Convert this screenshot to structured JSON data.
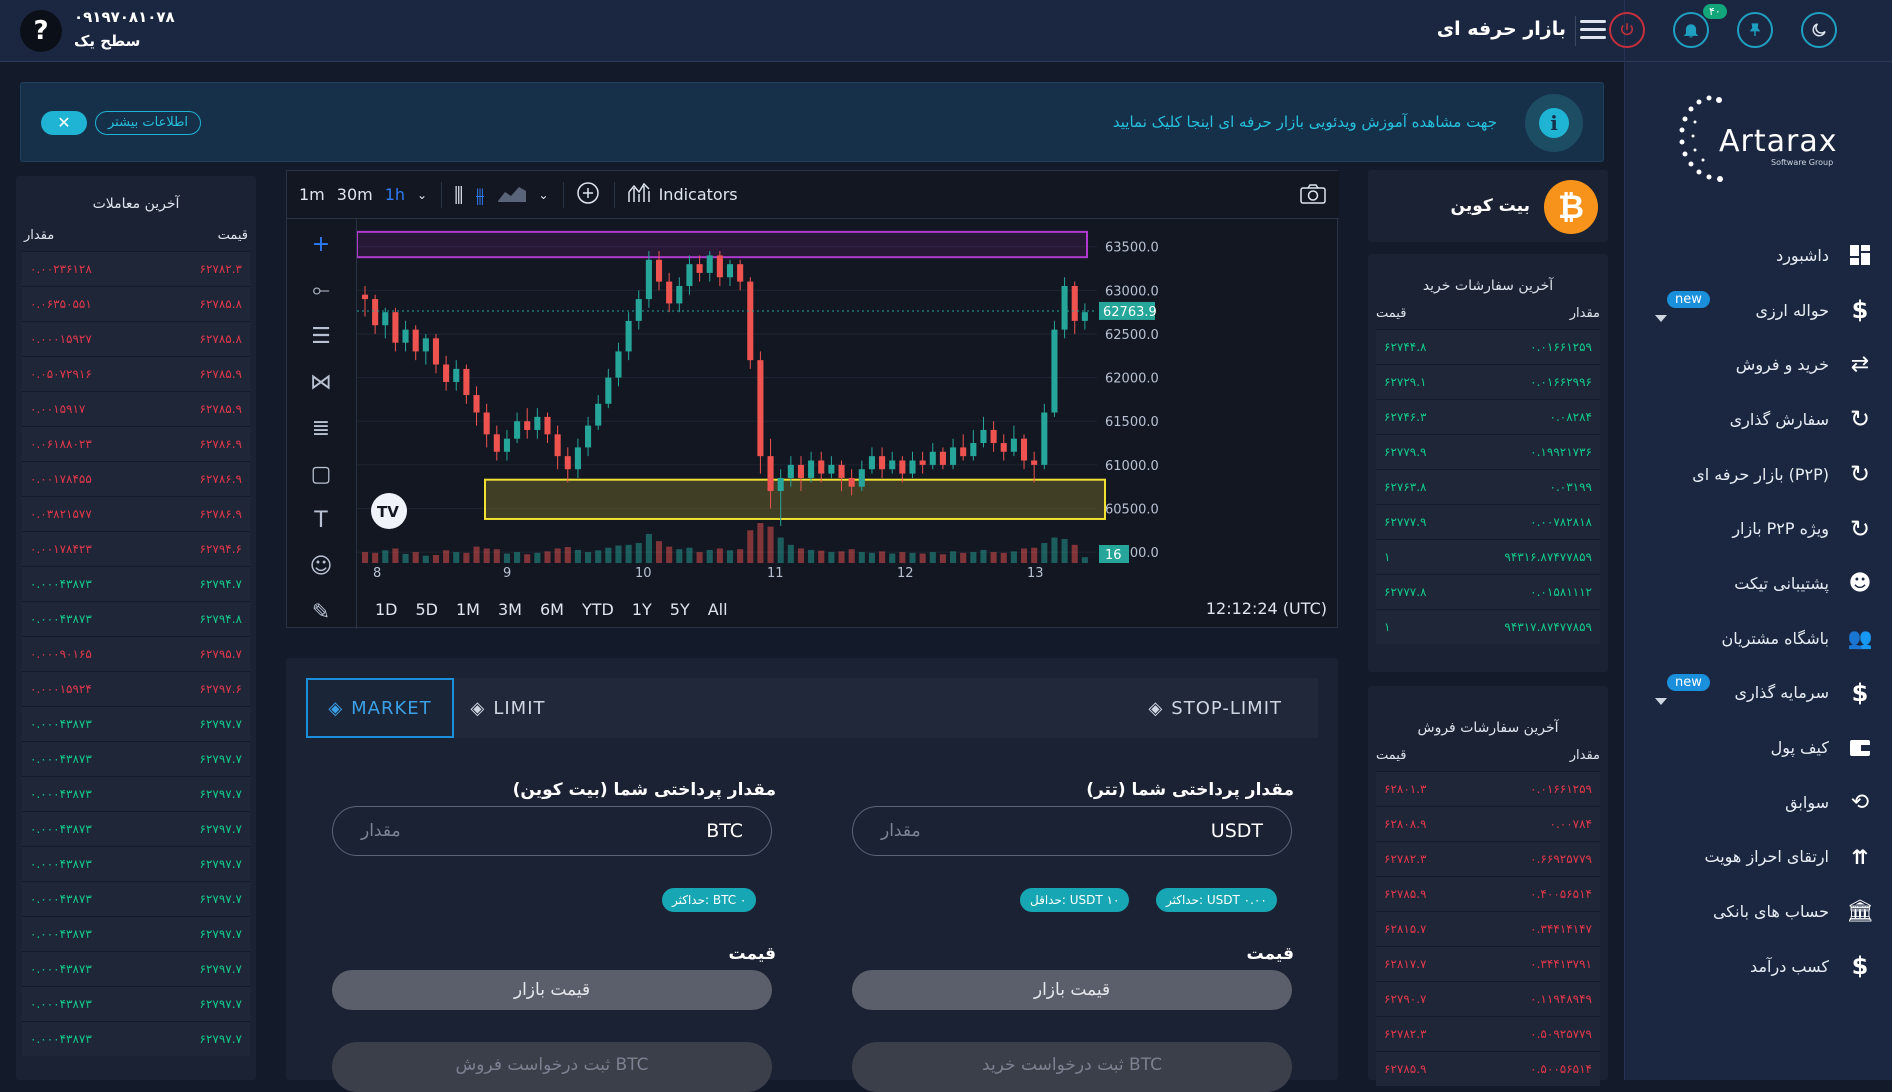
{
  "header": {
    "phone": "۰۹۱۹۷۰۸۱۰۷۸",
    "level": "سطح یک",
    "help_label": "?",
    "page_title": "بازار حرفه ای",
    "notif_count": "۴۰"
  },
  "banner": {
    "text": "جهت مشاهده آموزش ویدئویی بازار حرفه ای اینجا کلیک نمایید",
    "more_label": "اطلاعات بیشتر",
    "close_label": "✕",
    "info_label": "i"
  },
  "sidebar": {
    "logo_text": "Artarax",
    "logo_sub": "Software Group",
    "items": [
      {
        "label": "داشبورد",
        "icon": "dashboard-icon"
      },
      {
        "label": "حواله ارزی",
        "icon": "dollar-icon",
        "badge": "new"
      },
      {
        "label": "خرید و فروش",
        "icon": "exchange-icon"
      },
      {
        "label": "سفارش گذاری",
        "icon": "refresh-icon"
      },
      {
        "label": "بازار حرفه ای (P۲P)",
        "icon": "refresh-icon"
      },
      {
        "label": "بازار P۲P ویژه",
        "icon": "refresh-icon"
      },
      {
        "label": "پشتیبانی تیکت",
        "icon": "support-icon"
      },
      {
        "label": "باشگاه مشتریان",
        "icon": "users-icon"
      },
      {
        "label": "سرمایه گذاری",
        "icon": "dollar-icon",
        "badge": "new"
      },
      {
        "label": "کیف پول",
        "icon": "wallet-icon"
      },
      {
        "label": "سوابق",
        "icon": "history-icon"
      },
      {
        "label": "ارتقای احراز هویت",
        "icon": "chevrons-up-icon"
      },
      {
        "label": "حساب های بانکی",
        "icon": "bank-icon"
      },
      {
        "label": "کسب درآمد",
        "icon": "dollar-icon"
      }
    ]
  },
  "coin": {
    "name": "بیت کوین",
    "icon": "bitcoin-icon",
    "symbol": "₿"
  },
  "buy_orders": {
    "title": "آخرین سفارشات خرید",
    "col_amount": "مقدار",
    "col_price": "قیمت",
    "rows": [
      {
        "amount": "۰.۰۱۶۶۱۲۵۹",
        "price": "۶۲۷۴۴.۸"
      },
      {
        "amount": "۰.۰۱۶۶۲۹۹۶",
        "price": "۶۲۷۲۹.۱"
      },
      {
        "amount": "۰.۰۸۲۸۴",
        "price": "۶۲۷۴۶.۳"
      },
      {
        "amount": "۰.۱۹۹۲۱۷۳۶",
        "price": "۶۲۷۷۹.۹"
      },
      {
        "amount": "۰.۰۳۱۹۹",
        "price": "۶۲۷۶۳.۸"
      },
      {
        "amount": "۰.۰۰۷۸۲۸۱۸",
        "price": "۶۲۷۷۷.۹"
      },
      {
        "amount": "۹۴۳۱۶.۸۷۴۷۷۸۵۹",
        "price": "۱"
      },
      {
        "amount": "۰.۰۱۵۸۱۱۱۲",
        "price": "۶۲۷۷۷.۸"
      },
      {
        "amount": "۹۴۳۱۷.۸۷۴۷۷۸۵۹",
        "price": "۱"
      }
    ]
  },
  "sell_orders": {
    "title": "آخرین سفارشات فروش",
    "col_amount": "مقدار",
    "col_price": "قیمت",
    "rows": [
      {
        "amount": "۰.۰۱۶۶۱۲۵۹",
        "price": "۶۲۸۰۱.۳"
      },
      {
        "amount": "۰.۰۰۷۸۴",
        "price": "۶۲۸۰۸.۹"
      },
      {
        "amount": "۰.۶۶۹۲۵۷۷۹",
        "price": "۶۲۷۸۲.۳"
      },
      {
        "amount": "۰.۴۰۰۵۶۵۱۴",
        "price": "۶۲۷۸۵.۹"
      },
      {
        "amount": "۰.۳۴۴۱۴۱۴۷",
        "price": "۶۲۸۱۵.۷"
      },
      {
        "amount": "۰.۳۴۴۱۳۷۹۱",
        "price": "۶۲۸۱۷.۷"
      },
      {
        "amount": "۰.۱۱۹۴۸۹۴۹",
        "price": "۶۲۷۹۰.۷"
      },
      {
        "amount": "۰.۵۰۹۲۵۷۷۹",
        "price": "۶۲۷۸۲.۳"
      },
      {
        "amount": "۰.۵۰۰۵۶۵۱۴",
        "price": "۶۲۷۸۵.۹"
      }
    ]
  },
  "trades": {
    "title": "آخرین معاملات",
    "col_amount": "مقدار",
    "col_price": "قیمت",
    "rows": [
      {
        "amount": "۰.۰۰۲۳۶۱۲۸",
        "price": "۶۲۷۸۲.۳",
        "side": "sell"
      },
      {
        "amount": "۰.۰۶۳۵۰۵۵۱",
        "price": "۶۲۷۸۵.۸",
        "side": "sell"
      },
      {
        "amount": "۰.۰۰۰۱۵۹۲۷",
        "price": "۶۲۷۸۵.۸",
        "side": "sell"
      },
      {
        "amount": "۰.۰۵۰۷۲۹۱۶",
        "price": "۶۲۷۸۵.۹",
        "side": "sell"
      },
      {
        "amount": "۰.۰۰۱۵۹۱۷",
        "price": "۶۲۷۸۵.۹",
        "side": "sell"
      },
      {
        "amount": "۰.۰۶۱۸۸۰۲۳",
        "price": "۶۲۷۸۶.۹",
        "side": "sell"
      },
      {
        "amount": "۰.۰۰۱۷۸۴۵۵",
        "price": "۶۲۷۸۶.۹",
        "side": "sell"
      },
      {
        "amount": "۰.۰۳۸۲۱۵۷۷",
        "price": "۶۲۷۸۶.۹",
        "side": "sell"
      },
      {
        "amount": "۰.۰۰۱۷۸۴۲۳",
        "price": "۶۲۷۹۴.۶",
        "side": "sell"
      },
      {
        "amount": "۰.۰۰۰۴۳۸۷۳",
        "price": "۶۲۷۹۴.۷",
        "side": "buy"
      },
      {
        "amount": "۰.۰۰۰۴۳۸۷۳",
        "price": "۶۲۷۹۴.۸",
        "side": "buy"
      },
      {
        "amount": "۰.۰۰۰۹۰۱۶۵",
        "price": "۶۲۷۹۵.۷",
        "side": "sell"
      },
      {
        "amount": "۰.۰۰۰۱۵۹۲۴",
        "price": "۶۲۷۹۷.۶",
        "side": "sell"
      },
      {
        "amount": "۰.۰۰۰۴۳۸۷۳",
        "price": "۶۲۷۹۷.۷",
        "side": "buy"
      },
      {
        "amount": "۰.۰۰۰۴۳۸۷۳",
        "price": "۶۲۷۹۷.۷",
        "side": "buy"
      },
      {
        "amount": "۰.۰۰۰۴۳۸۷۳",
        "price": "۶۲۷۹۷.۷",
        "side": "buy"
      },
      {
        "amount": "۰.۰۰۰۴۳۸۷۳",
        "price": "۶۲۷۹۷.۷",
        "side": "buy"
      },
      {
        "amount": "۰.۰۰۰۴۳۸۷۳",
        "price": "۶۲۷۹۷.۷",
        "side": "buy"
      },
      {
        "amount": "۰.۰۰۰۴۳۸۷۳",
        "price": "۶۲۷۹۷.۷",
        "side": "buy"
      },
      {
        "amount": "۰.۰۰۰۴۳۸۷۳",
        "price": "۶۲۷۹۷.۷",
        "side": "buy"
      },
      {
        "amount": "۰.۰۰۰۴۳۸۷۳",
        "price": "۶۲۷۹۷.۷",
        "side": "buy"
      },
      {
        "amount": "۰.۰۰۰۴۳۸۷۳",
        "price": "۶۲۷۹۷.۷",
        "side": "buy"
      },
      {
        "amount": "۰.۰۰۰۴۳۸۷۳",
        "price": "۶۲۷۹۷.۷",
        "side": "buy"
      }
    ]
  },
  "chart_toolbar": {
    "intervals": [
      "1m",
      "30m",
      "1h"
    ],
    "active_interval": "1h",
    "indicators_label": "Indicators"
  },
  "chart_footer": {
    "ranges": [
      "1D",
      "5D",
      "1M",
      "3M",
      "6M",
      "YTD",
      "1Y",
      "5Y",
      "All"
    ],
    "clock": "12:12:24 (UTC)"
  },
  "chart_data": {
    "type": "candlestick",
    "x_ticks": [
      "8",
      "9",
      "10",
      "11",
      "12",
      "13"
    ],
    "y_ticks": [
      63500.0,
      63000.0,
      62500.0,
      62000.0,
      61500.0,
      61000.0,
      60500.0,
      60000.0
    ],
    "ylim": [
      59990,
      63680
    ],
    "last_price": "62763.9",
    "last_volume": "16",
    "resistance_zone": [
      63380,
      63670
    ],
    "support_zone": [
      60380,
      60830
    ],
    "candles": [
      [
        62950,
        62900,
        63050,
        62700
      ],
      [
        62900,
        62600,
        62950,
        62500
      ],
      [
        62600,
        62750,
        62800,
        62450
      ],
      [
        62750,
        62400,
        62800,
        62300
      ],
      [
        62400,
        62550,
        62650,
        62300
      ],
      [
        62550,
        62300,
        62600,
        62200
      ],
      [
        62300,
        62450,
        62500,
        62150
      ],
      [
        62450,
        62150,
        62500,
        62050
      ],
      [
        62150,
        61950,
        62250,
        61850
      ],
      [
        61950,
        62100,
        62200,
        61850
      ],
      [
        62100,
        61800,
        62150,
        61700
      ],
      [
        61800,
        61600,
        61900,
        61450
      ],
      [
        61600,
        61350,
        61700,
        61200
      ],
      [
        61350,
        61150,
        61450,
        61050
      ],
      [
        61150,
        61300,
        61400,
        61050
      ],
      [
        61300,
        61500,
        61600,
        61250
      ],
      [
        61500,
        61400,
        61650,
        61300
      ],
      [
        61400,
        61550,
        61650,
        61300
      ],
      [
        61550,
        61350,
        61600,
        61250
      ],
      [
        61350,
        61100,
        61450,
        60950
      ],
      [
        61100,
        60950,
        61200,
        60800
      ],
      [
        60950,
        61200,
        61300,
        60850
      ],
      [
        61200,
        61450,
        61550,
        61100
      ],
      [
        61450,
        61700,
        61800,
        61400
      ],
      [
        61700,
        62000,
        62100,
        61650
      ],
      [
        62000,
        62300,
        62400,
        61900
      ],
      [
        62300,
        62650,
        62750,
        62200
      ],
      [
        62650,
        62900,
        63000,
        62550
      ],
      [
        62900,
        63350,
        63450,
        62800
      ],
      [
        63350,
        63100,
        63450,
        63000
      ],
      [
        63100,
        62850,
        63200,
        62750
      ],
      [
        62850,
        63050,
        63150,
        62750
      ],
      [
        63050,
        63300,
        63400,
        62950
      ],
      [
        63300,
        63200,
        63400,
        63100
      ],
      [
        63200,
        63400,
        63450,
        63100
      ],
      [
        63400,
        63150,
        63450,
        63050
      ],
      [
        63150,
        63300,
        63350,
        63050
      ],
      [
        63300,
        63100,
        63350,
        63000
      ],
      [
        63100,
        62200,
        63150,
        62100
      ],
      [
        62200,
        61100,
        62300,
        60900
      ],
      [
        61100,
        60700,
        61300,
        60500
      ],
      [
        60700,
        60850,
        60950,
        60300
      ],
      [
        60850,
        61000,
        61100,
        60750
      ],
      [
        61000,
        60850,
        61100,
        60700
      ],
      [
        60850,
        61050,
        61150,
        60800
      ],
      [
        61050,
        60900,
        61150,
        60800
      ],
      [
        60900,
        61000,
        61100,
        60850
      ],
      [
        61000,
        60850,
        61050,
        60700
      ],
      [
        60850,
        60750,
        60950,
        60650
      ],
      [
        60750,
        60950,
        61050,
        60700
      ],
      [
        60950,
        61100,
        61200,
        60900
      ],
      [
        61100,
        60950,
        61200,
        60850
      ],
      [
        60950,
        61050,
        61150,
        60900
      ],
      [
        61050,
        60900,
        61100,
        60800
      ],
      [
        60900,
        61050,
        61150,
        60850
      ],
      [
        61050,
        61000,
        61150,
        60900
      ],
      [
        61000,
        61150,
        61250,
        60950
      ],
      [
        61150,
        61000,
        61200,
        60950
      ],
      [
        61000,
        61200,
        61300,
        60950
      ],
      [
        61200,
        61100,
        61350,
        61050
      ],
      [
        61100,
        61250,
        61400,
        61050
      ],
      [
        61250,
        61400,
        61550,
        61200
      ],
      [
        61400,
        61250,
        61500,
        61150
      ],
      [
        61250,
        61150,
        61350,
        61050
      ],
      [
        61150,
        61300,
        61450,
        61100
      ],
      [
        61300,
        61050,
        61350,
        60950
      ],
      [
        61050,
        61000,
        61150,
        60800
      ],
      [
        61000,
        61600,
        61700,
        60950
      ],
      [
        61600,
        62550,
        62650,
        61550
      ],
      [
        62550,
        63050,
        63150,
        62450
      ],
      [
        63050,
        62650,
        63100,
        62500
      ],
      [
        62650,
        62750,
        62850,
        62550
      ]
    ],
    "volumes": [
      30,
      28,
      35,
      40,
      25,
      30,
      20,
      22,
      35,
      30,
      28,
      45,
      40,
      38,
      26,
      30,
      24,
      28,
      32,
      40,
      44,
      36,
      30,
      35,
      42,
      48,
      50,
      55,
      80,
      60,
      45,
      38,
      42,
      30,
      36,
      40,
      35,
      38,
      90,
      110,
      100,
      70,
      50,
      40,
      36,
      34,
      30,
      32,
      38,
      30,
      28,
      32,
      26,
      30,
      28,
      26,
      30,
      24,
      32,
      28,
      30,
      36,
      30,
      28,
      32,
      40,
      42,
      55,
      70,
      66,
      50,
      16
    ]
  }
}
